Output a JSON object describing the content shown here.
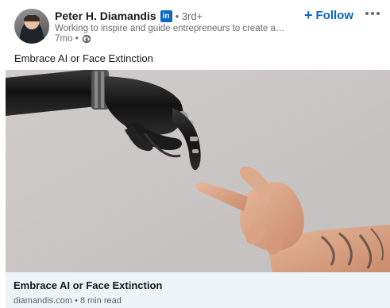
{
  "post": {
    "author": {
      "name": "Peter H. Diamandis",
      "badge": "in",
      "degree": "• 3rd+",
      "headline": "Working to inspire and guide entrepreneurs to create a ho…",
      "time": "7mo •",
      "visibility_icon": "globe-icon",
      "avatar_icon": "profile-photo"
    },
    "follow_label": "Follow",
    "follow_icon": "plus-icon",
    "more_icon": "more-options-icon",
    "commentary": "Embrace AI or Face Extinction",
    "article": {
      "image_icon": "robot-hand-and-human-hand-photo",
      "title": "Embrace AI or Face Extinction",
      "meta": "diamandis.com • 8 min read"
    }
  },
  "colors": {
    "accent": "#0a66c2",
    "footer_bg": "#eef3f8",
    "image_bg": "#c9c6c5"
  }
}
